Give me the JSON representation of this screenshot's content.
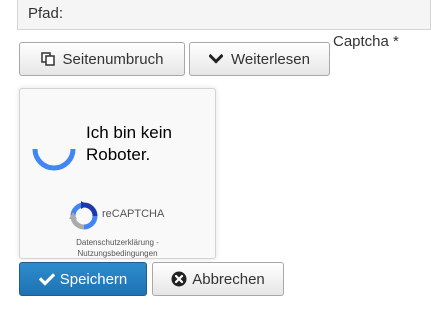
{
  "path_bar": {
    "label": "Pfad:"
  },
  "toolbar": {
    "pagebreak_label": "Seitenumbruch",
    "pagebreak_icon": "copy-icon",
    "readmore_label": "Weiterlesen",
    "readmore_icon": "chevron-down-icon"
  },
  "captcha": {
    "label": "Captcha *",
    "checkbox_text": "Ich bin kein Roboter.",
    "brand": "reCAPTCHA",
    "privacy_link": "Datenschutzerklärung",
    "separator": " - ",
    "terms_link": "Nutzungsbedingungen",
    "spinner_color": "#4285f4"
  },
  "actions": {
    "save_label": "Speichern",
    "save_icon": "check-icon",
    "save_color": "#1e72b3",
    "cancel_label": "Abbrechen",
    "cancel_icon": "times-circle-icon"
  }
}
